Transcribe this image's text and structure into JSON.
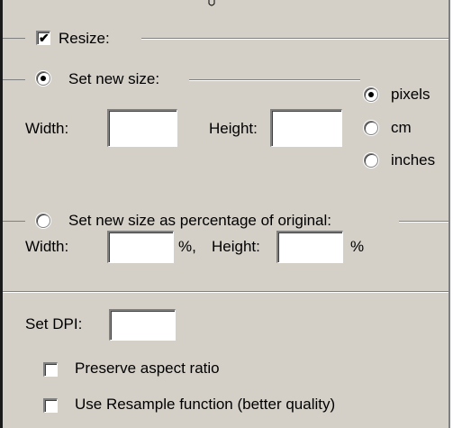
{
  "resize": {
    "label": "Resize:",
    "checked": true
  },
  "new_size": {
    "label": "Set new size:",
    "selected": true,
    "width_label": "Width:",
    "width_value": "",
    "height_label": "Height:",
    "height_value": "",
    "units": [
      {
        "label": "pixels",
        "selected": true
      },
      {
        "label": "cm",
        "selected": false
      },
      {
        "label": "inches",
        "selected": false
      }
    ]
  },
  "percentage": {
    "label": "Set new size as percentage of original:",
    "selected": false,
    "width_label": "Width:",
    "width_value": "",
    "percent_comma": "%,",
    "height_label": "Height:",
    "height_value": "",
    "percent": "%"
  },
  "dpi": {
    "label": "Set DPI:",
    "value": ""
  },
  "preserve_aspect": {
    "label": "Preserve aspect ratio",
    "checked": false
  },
  "resample": {
    "label": "Use Resample function (better quality)",
    "checked": false
  },
  "colors": {
    "face": "#d4d0c8",
    "shadow": "#808080",
    "highlight": "#ffffff"
  }
}
